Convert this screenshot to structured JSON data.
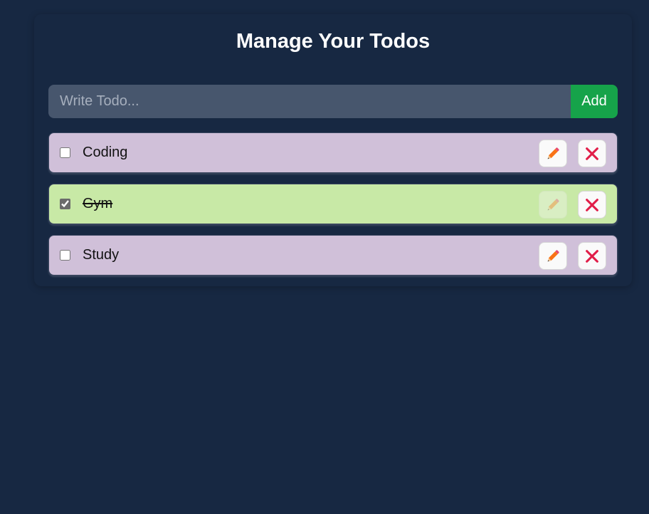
{
  "header": {
    "title": "Manage Your Todos"
  },
  "form": {
    "placeholder": "Write Todo...",
    "value": "",
    "add_label": "Add"
  },
  "todos": [
    {
      "text": "Coding",
      "completed": false
    },
    {
      "text": "Gym",
      "completed": true
    },
    {
      "text": "Study",
      "completed": false
    }
  ],
  "icons": {
    "edit": "pencil-icon",
    "delete": "close-icon"
  },
  "colors": {
    "background": "#172842",
    "input_bg": "#47566d",
    "add_button": "#16a34a",
    "todo_pending": "#d0c0d9",
    "todo_completed": "#c8e9a6",
    "delete_icon": "#e11d48",
    "pencil_body": "#f97316"
  }
}
